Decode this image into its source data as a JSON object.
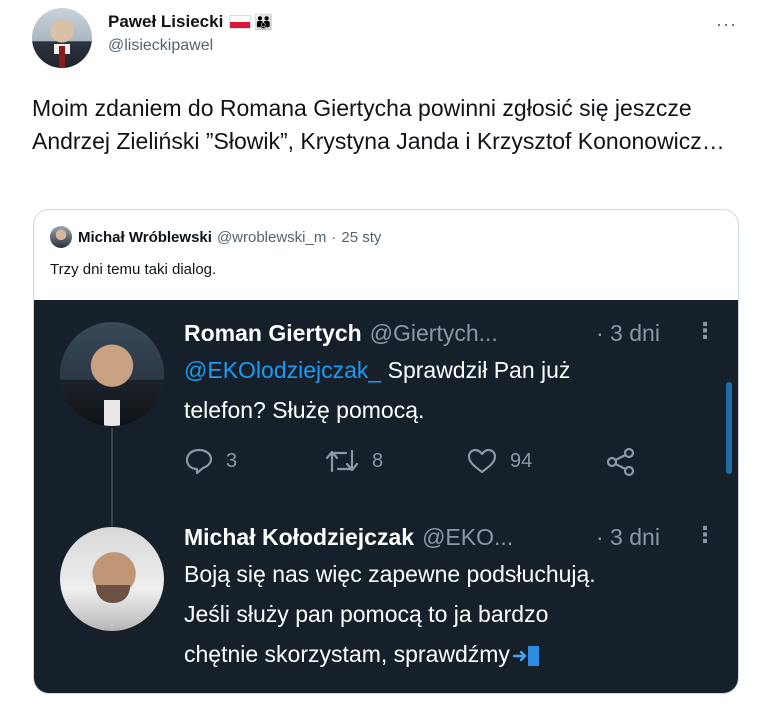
{
  "tweet": {
    "author_name": "Paweł Lisiecki",
    "author_handle": "@lisieckipawel",
    "more_label": "···",
    "text": "Moim zdaniem do Romana Giertycha powinni zgłosić się jeszcze Andrzej Zieliński ”Słowik”, Krystyna Janda  i Krzysztof Kononowicz…",
    "name_emojis": [
      "polish-flag",
      "family-emoji"
    ]
  },
  "quote": {
    "author_name": "Michał Wróblewski",
    "author_handle": "@wroblewski_m",
    "separator": "·",
    "date": "25 sty",
    "text": "Trzy dni temu taki dialog."
  },
  "screenshot": {
    "tweet1": {
      "name": "Roman Giertych",
      "handle": "@Giertych...",
      "date": "· 3 dni",
      "more": "⋮",
      "mention": "@EKOlodziejczak_",
      "text_line1_rest": " Sprawdził Pan już",
      "text_line2": "telefon? Służę pomocą.",
      "replies": "3",
      "retweets": "8",
      "likes": "94"
    },
    "tweet2": {
      "name": "Michał Kołodziejczak",
      "handle": "@EKO...",
      "date": "· 3 dni",
      "more": "⋮",
      "line1": "Boją się nas więc zapewne podsłuchują.",
      "line2": "Jeśli służy pan pomocą to ja bardzo",
      "line3": "chętnie skorzystam, sprawdźmy"
    }
  },
  "colors": {
    "dark_bg": "#15202b",
    "link": "#1d9bf0",
    "muted": "#536471"
  }
}
